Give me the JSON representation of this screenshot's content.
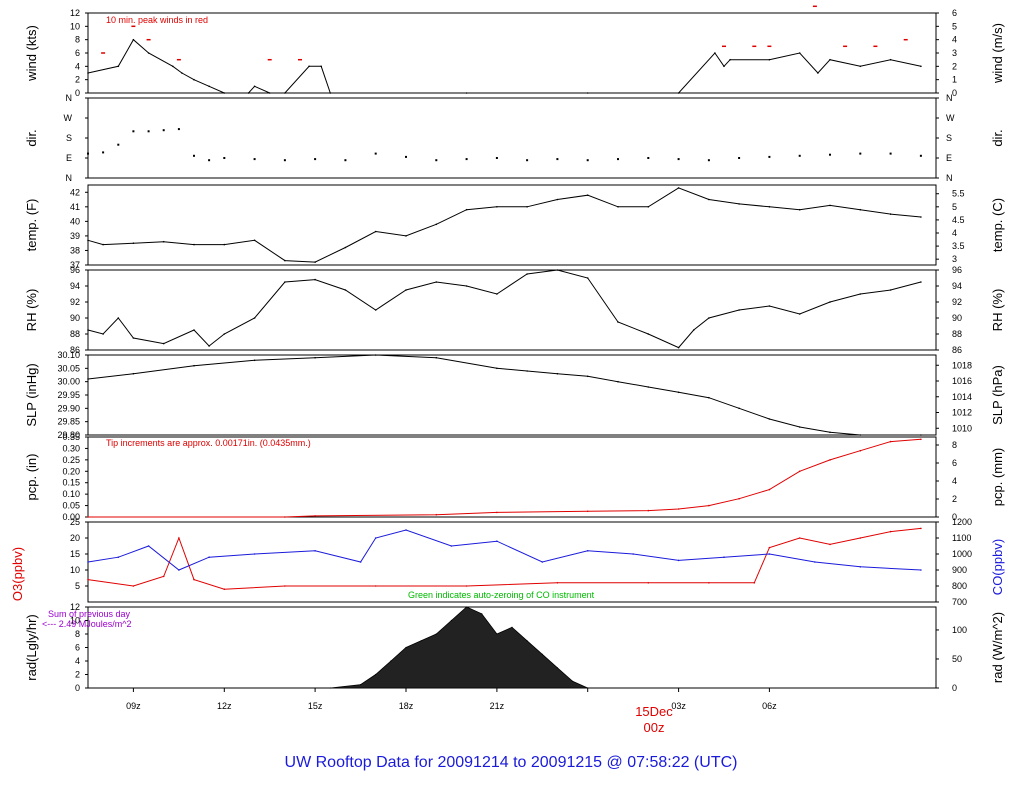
{
  "footer_title": "UW Rooftop Data for 20091214  to  20091215 @ 07:58:22  (UTC)",
  "date_label": {
    "day": "15Dec",
    "hour": "00z"
  },
  "time_ticks": [
    "09z",
    "12z",
    "15z",
    "18z",
    "21z",
    "00z",
    "03z",
    "06z"
  ],
  "colors": {
    "primary": "#000000",
    "accent_red": "#e00000",
    "co_blue": "#1a1adb",
    "zeroing_green": "#00bb00",
    "annotation_purple": "#9900cc"
  },
  "chart_data": [
    {
      "type": "line",
      "panel": "wind",
      "left_label": "wind (kts)",
      "right_label": "wind (m/s)",
      "annotation": "10 min. peak winds in red",
      "ylim": [
        0,
        12
      ],
      "left_ticks": [
        0,
        2,
        4,
        6,
        8,
        10,
        12
      ],
      "right_ticks": [
        0,
        1,
        2,
        3,
        4,
        5,
        6
      ],
      "x_hours": [
        7.5,
        8.5,
        9.0,
        9.5,
        10.3,
        10.6,
        11.0,
        11.5,
        12.0,
        12.8,
        13.0,
        13.5,
        14.0,
        14.8,
        15.2,
        15.5,
        20.0,
        24.0,
        27.0,
        28.2,
        28.5,
        28.7,
        30.0,
        31.0,
        32.0,
        33.0,
        34.0,
        35.0,
        31.6
      ],
      "values": [
        3,
        4,
        8,
        6,
        4,
        3,
        2,
        1,
        0,
        0,
        1,
        0,
        0,
        4,
        4,
        0,
        0,
        0,
        0,
        6,
        4,
        5,
        5,
        6,
        5,
        4,
        5,
        4,
        3
      ],
      "peak_x_hours": [
        8.0,
        9.0,
        9.5,
        10.5,
        13.5,
        14.5,
        28.5,
        29.5,
        30.0,
        31.5,
        32.5,
        33.5,
        34.5
      ],
      "peak_values": [
        6,
        10,
        8,
        5,
        5,
        5,
        7,
        7,
        7,
        13,
        7,
        7,
        8
      ]
    },
    {
      "type": "scatter",
      "panel": "direction",
      "left_label": "dir.",
      "right_label": "dir.",
      "categories": [
        "N",
        "E",
        "S",
        "W",
        "N"
      ],
      "ylim": [
        0,
        360
      ],
      "x_hours": [
        7.5,
        8.0,
        8.5,
        9.0,
        9.5,
        10.0,
        10.5,
        11.0,
        11.5,
        12.0,
        13.0,
        14.0,
        15.0,
        16.0,
        17.0,
        18.0,
        19.0,
        20.0,
        21.0,
        22.0,
        23.0,
        24.0,
        25.0,
        26.0,
        27.0,
        28.0,
        29.0,
        30.0,
        31.0,
        32.0,
        33.0,
        34.0,
        35.0
      ],
      "values": [
        110,
        115,
        150,
        210,
        210,
        215,
        220,
        100,
        80,
        90,
        85,
        80,
        85,
        80,
        110,
        95,
        80,
        85,
        90,
        80,
        85,
        80,
        85,
        90,
        85,
        80,
        90,
        95,
        100,
        105,
        110,
        110,
        100
      ]
    },
    {
      "type": "line",
      "panel": "temperature",
      "left_label": "temp. (F)",
      "right_label": "temp. (C)",
      "ylim": [
        37,
        42.5
      ],
      "left_ticks": [
        37,
        38,
        39,
        40,
        41,
        42
      ],
      "right_ticks": [
        3,
        3.5,
        4,
        4.5,
        5,
        5.5
      ],
      "x_hours": [
        7.5,
        8.0,
        9.0,
        10.0,
        11.0,
        12.0,
        13.0,
        14.0,
        15.0,
        16.0,
        17.0,
        18.0,
        19.0,
        20.0,
        21.0,
        22.0,
        23.0,
        24.0,
        25.0,
        26.0,
        27.0,
        28.0,
        29.0,
        30.0,
        31.0,
        32.0,
        33.0,
        34.0,
        35.0
      ],
      "values": [
        38.7,
        38.4,
        38.5,
        38.6,
        38.4,
        38.4,
        38.7,
        37.3,
        37.2,
        38.2,
        39.3,
        39.0,
        39.8,
        40.8,
        41.0,
        41.0,
        41.5,
        41.8,
        41.0,
        41.0,
        42.3,
        41.5,
        41.2,
        41.0,
        40.8,
        41.1,
        40.8,
        40.5,
        40.3
      ]
    },
    {
      "type": "line",
      "panel": "relative_humidity",
      "left_label": "RH (%)",
      "right_label": "RH (%)",
      "ylim": [
        86,
        96
      ],
      "left_ticks": [
        86,
        88,
        90,
        92,
        94,
        96
      ],
      "right_ticks": [
        86,
        88,
        90,
        92,
        94,
        96
      ],
      "x_hours": [
        7.5,
        8.0,
        8.5,
        9.0,
        10.0,
        11.0,
        11.5,
        12.0,
        13.0,
        14.0,
        15.0,
        16.0,
        17.0,
        18.0,
        19.0,
        20.0,
        21.0,
        22.0,
        23.0,
        24.0,
        25.0,
        26.0,
        27.0,
        27.5,
        28.0,
        29.0,
        30.0,
        31.0,
        32.0,
        33.0,
        34.0,
        35.0
      ],
      "values": [
        88.5,
        88.0,
        90.0,
        87.5,
        86.8,
        88.5,
        86.5,
        88.0,
        90.0,
        94.5,
        94.8,
        93.5,
        91.0,
        93.5,
        94.5,
        94.0,
        93.0,
        95.5,
        96.0,
        95.0,
        89.5,
        88.0,
        86.3,
        88.5,
        90.0,
        91.0,
        91.5,
        90.5,
        92.0,
        93.0,
        93.5,
        94.5
      ]
    },
    {
      "type": "line",
      "panel": "sea_level_pressure",
      "left_label": "SLP (inHg)",
      "right_label": "SLP (hPa)",
      "ylim": [
        29.8,
        30.1
      ],
      "left_ticks": [
        29.8,
        29.85,
        29.9,
        29.95,
        30.0,
        30.05,
        30.1
      ],
      "right_ticks": [
        1010,
        1012,
        1014,
        1016,
        1018
      ],
      "x_hours": [
        7.5,
        9.0,
        11.0,
        13.0,
        15.0,
        17.0,
        19.0,
        21.0,
        22.0,
        23.0,
        24.0,
        25.0,
        26.0,
        27.0,
        28.0,
        29.0,
        30.0,
        31.0,
        32.0,
        33.0,
        35.0
      ],
      "values": [
        30.01,
        30.03,
        30.06,
        30.08,
        30.09,
        30.1,
        30.09,
        30.05,
        30.04,
        30.03,
        30.02,
        30.0,
        29.98,
        29.96,
        29.94,
        29.9,
        29.86,
        29.83,
        29.81,
        29.8,
        29.8
      ]
    },
    {
      "type": "line",
      "panel": "precipitation",
      "left_label": "pcp. (in)",
      "right_label": "pcp. (mm)",
      "annotation": "Tip increments are approx. 0.00171in. (0.0435mm.)",
      "ylim": [
        0,
        0.35
      ],
      "left_ticks": [
        0.0,
        0.05,
        0.1,
        0.15,
        0.2,
        0.25,
        0.3,
        0.35
      ],
      "right_ticks": [
        0,
        2,
        4,
        6,
        8
      ],
      "x_hours": [
        7.5,
        14.0,
        15.0,
        19.0,
        21.0,
        24.0,
        26.0,
        27.0,
        28.0,
        29.0,
        30.0,
        31.0,
        32.0,
        33.0,
        34.0,
        35.0
      ],
      "values": [
        0.0,
        0.0,
        0.005,
        0.01,
        0.02,
        0.025,
        0.028,
        0.035,
        0.05,
        0.08,
        0.12,
        0.2,
        0.25,
        0.29,
        0.33,
        0.34
      ]
    },
    {
      "type": "line",
      "panel": "ozone_and_co",
      "left_label": "O3(ppbv)",
      "right_label": "CO(ppbv)",
      "annotation": "Green indicates auto-zeroing of CO instrument",
      "left_ylim": [
        0,
        25
      ],
      "left_ticks": [
        5,
        10,
        15,
        20,
        25
      ],
      "right_ylim": [
        700,
        1200
      ],
      "right_ticks": [
        700,
        800,
        900,
        1000,
        1100,
        1200
      ],
      "series": [
        {
          "name": "O3",
          "x_hours": [
            7.5,
            9.0,
            10.0,
            10.5,
            11.0,
            12.0,
            14.0,
            17.0,
            20.0,
            23.0,
            26.0,
            28.0,
            29.5,
            30.0,
            31.0,
            32.0,
            33.0,
            34.0,
            35.0
          ],
          "values": [
            7,
            5,
            8,
            20,
            7,
            4,
            5,
            5,
            5,
            6,
            6,
            6,
            6,
            17,
            20,
            18,
            20,
            22,
            23
          ]
        },
        {
          "name": "CO",
          "x_hours": [
            7.5,
            8.5,
            9.5,
            10.5,
            11.5,
            13.0,
            15.0,
            16.5,
            17.0,
            18.0,
            19.5,
            21.0,
            22.5,
            24.0,
            25.5,
            27.0,
            28.5,
            30.0,
            31.5,
            33.0,
            35.0
          ],
          "values": [
            950,
            980,
            1050,
            900,
            980,
            1000,
            1020,
            950,
            1100,
            1150,
            1050,
            1080,
            950,
            1020,
            1000,
            960,
            980,
            1000,
            950,
            920,
            900
          ]
        }
      ]
    },
    {
      "type": "area",
      "panel": "solar_radiation",
      "left_label": "rad(Lgly/hr)",
      "right_label": "rad (W/m^2)",
      "annotation_lines": [
        "Sum of previous day",
        "<--- 2.49 MJoules/m^2"
      ],
      "ylim": [
        0,
        12
      ],
      "left_ticks": [
        0,
        2,
        4,
        6,
        8,
        10,
        12
      ],
      "right_ticks": [
        0,
        50,
        100
      ],
      "x_hours": [
        7.5,
        15.5,
        16.5,
        17.0,
        17.5,
        18.0,
        18.5,
        19.0,
        19.5,
        20.0,
        20.5,
        21.0,
        21.5,
        22.0,
        22.5,
        23.0,
        23.5,
        24.0
      ],
      "values": [
        0,
        0,
        0.5,
        2,
        4,
        6,
        7,
        8,
        10,
        12,
        11,
        8,
        9,
        7,
        5,
        3,
        1,
        0
      ]
    }
  ]
}
